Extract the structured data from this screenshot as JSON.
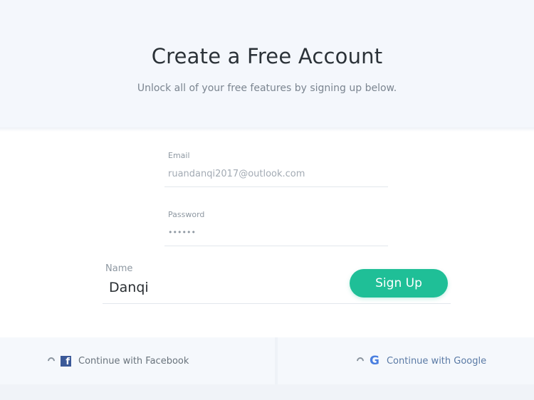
{
  "header": {
    "title": "Create a Free Account",
    "subtitle": "Unlock all of your free features by signing up below."
  },
  "form": {
    "email": {
      "label": "Email",
      "value": "ruandanqi2017@outlook.com"
    },
    "password": {
      "label": "Password",
      "value": "••••••"
    },
    "name": {
      "label": "Name",
      "value": "Danqi"
    },
    "submit_label": "Sign Up"
  },
  "social": {
    "facebook": {
      "label": "Continue with Facebook",
      "icon": "facebook-icon"
    },
    "google": {
      "label": "Continue with Google",
      "icon": "google-icon"
    }
  },
  "colors": {
    "accent": "#1fbf97",
    "facebook": "#3b5998",
    "google": "#4a7fe0",
    "header_bg": "#f4f7fc"
  }
}
